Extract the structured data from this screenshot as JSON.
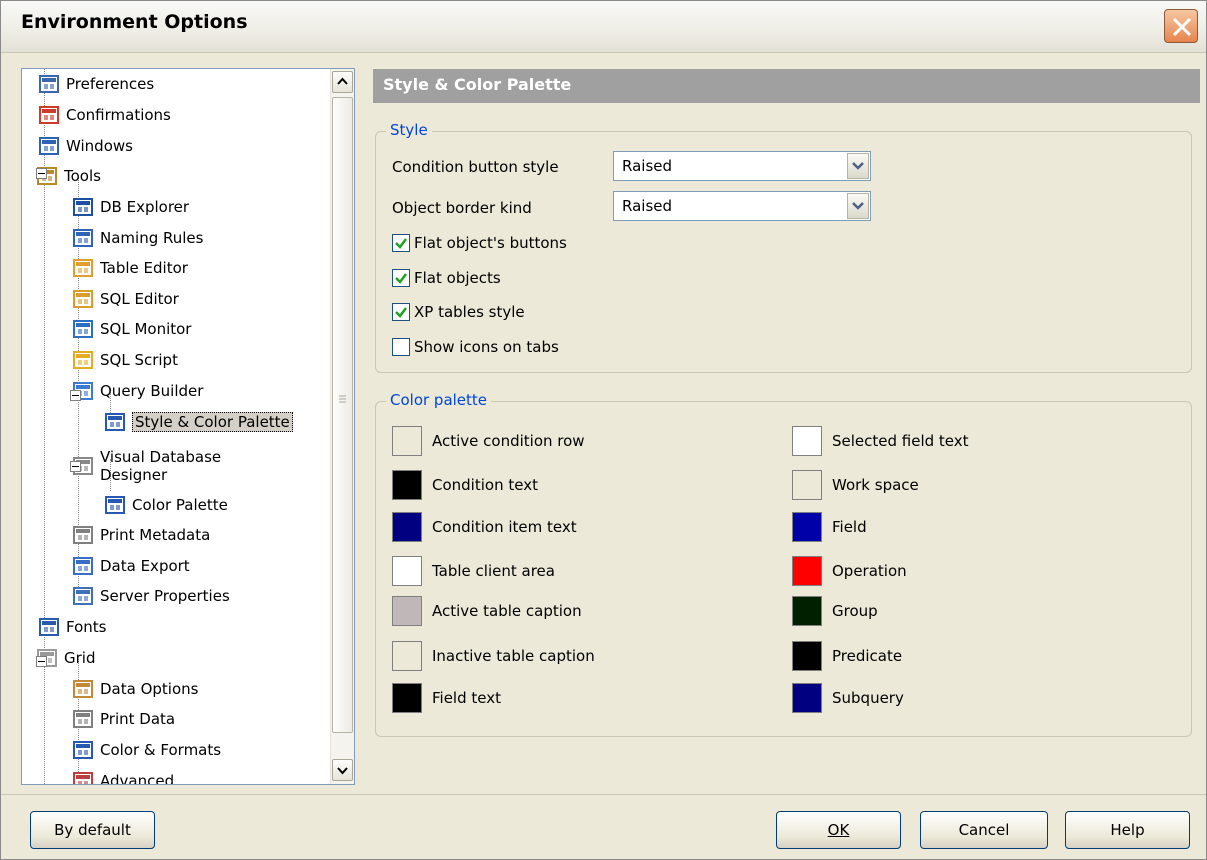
{
  "window": {
    "title": "Environment Options"
  },
  "tree": {
    "items": [
      {
        "label": "Preferences",
        "icon": "preferences-icon"
      },
      {
        "label": "Confirmations",
        "icon": "confirmations-icon"
      },
      {
        "label": "Windows",
        "icon": "windows-icon"
      },
      {
        "label": "Tools",
        "icon": "tools-icon"
      },
      {
        "label": "DB Explorer",
        "icon": "db-explorer-icon"
      },
      {
        "label": "Naming Rules",
        "icon": "naming-rules-icon"
      },
      {
        "label": "Table Editor",
        "icon": "table-editor-icon"
      },
      {
        "label": "SQL Editor",
        "icon": "sql-editor-icon"
      },
      {
        "label": "SQL Monitor",
        "icon": "sql-monitor-icon"
      },
      {
        "label": "SQL Script",
        "icon": "sql-script-icon"
      },
      {
        "label": "Query Builder",
        "icon": "query-builder-icon"
      },
      {
        "label": "Style & Color Palette",
        "icon": "palette-grid-icon"
      },
      {
        "label": "Visual Database",
        "label2": "Designer",
        "icon": "designer-icon"
      },
      {
        "label": "Color Palette",
        "icon": "palette-grid-icon"
      },
      {
        "label": "Print Metadata",
        "icon": "printer-icon"
      },
      {
        "label": "Data Export",
        "icon": "data-export-icon"
      },
      {
        "label": "Server Properties",
        "icon": "server-icon"
      },
      {
        "label": "Fonts",
        "icon": "fonts-icon"
      },
      {
        "label": "Grid",
        "icon": "grid-icon"
      },
      {
        "label": "Data Options",
        "icon": "data-options-icon"
      },
      {
        "label": "Print Data",
        "icon": "printer-icon"
      },
      {
        "label": "Color & Formats",
        "icon": "palette-grid-icon"
      },
      {
        "label": "Advanced",
        "icon": "advanced-icon"
      }
    ]
  },
  "panel": {
    "title": "Style & Color Palette",
    "style_group": {
      "title": "Style",
      "condition_button_style_label": "Condition button style",
      "condition_button_style_value": "Raised",
      "object_border_kind_label": "Object border kind",
      "object_border_kind_value": "Raised",
      "checks": [
        {
          "label": "Flat object's buttons",
          "checked": true
        },
        {
          "label": "Flat objects",
          "checked": true
        },
        {
          "label": "XP tables style",
          "checked": true
        },
        {
          "label": "Show icons on tabs",
          "checked": false
        }
      ]
    },
    "palette_group": {
      "title": "Color palette",
      "left": [
        {
          "label": "Active condition row",
          "color": "#ece9d8"
        },
        {
          "label": "Condition text",
          "color": "#000000"
        },
        {
          "label": "Condition item text",
          "color": "#000080"
        },
        {
          "label": "Table client area",
          "color": "#ffffff"
        },
        {
          "label": "Active table caption",
          "color": "#c0b8b8"
        },
        {
          "label": "Inactive table caption",
          "color": "#ece9d8"
        },
        {
          "label": "Field text",
          "color": "#000000"
        }
      ],
      "right": [
        {
          "label": "Selected field text",
          "color": "#ffffff"
        },
        {
          "label": "Work space",
          "color": "#ece9d8"
        },
        {
          "label": "Field",
          "color": "#0000a8"
        },
        {
          "label": "Operation",
          "color": "#ff0000"
        },
        {
          "label": "Group",
          "color": "#002000"
        },
        {
          "label": "Predicate",
          "color": "#000000"
        },
        {
          "label": "Subquery",
          "color": "#000080"
        }
      ]
    }
  },
  "buttons": {
    "by_default": "By default",
    "ok": "OK",
    "cancel": "Cancel",
    "help": "Help"
  }
}
